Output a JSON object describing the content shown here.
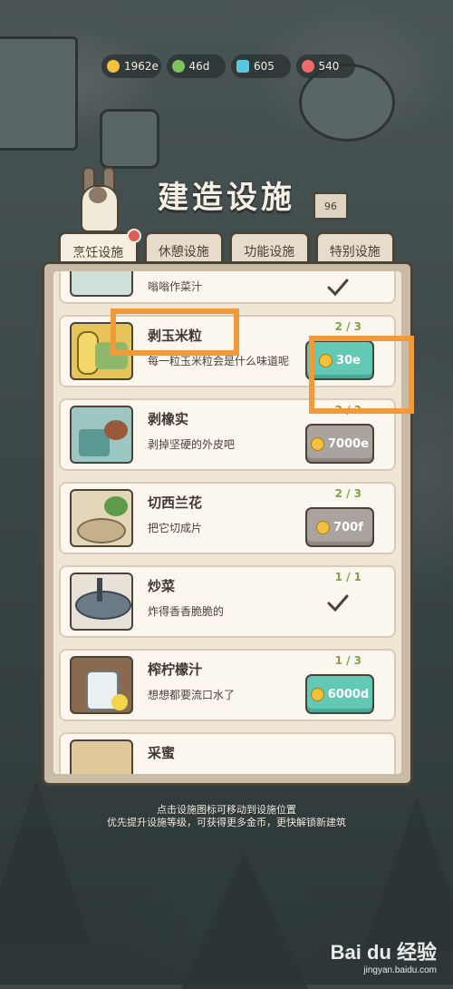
{
  "resources": [
    {
      "icon": "coin-icon",
      "value": "1962e",
      "color": "#f2c23c"
    },
    {
      "icon": "leaf-icon",
      "value": "46d",
      "color": "#7fc25a"
    },
    {
      "icon": "gem-icon",
      "value": "605",
      "color": "#5cc6e0"
    },
    {
      "icon": "heart-icon",
      "value": "540",
      "color": "#ef6a6a"
    }
  ],
  "header": {
    "title": "建造设施",
    "sign": "96"
  },
  "tabs": [
    {
      "label": "烹饪设施",
      "active": true,
      "badge": true
    },
    {
      "label": "休憩设施"
    },
    {
      "label": "功能设施"
    },
    {
      "label": "特别设施"
    }
  ],
  "items": [
    {
      "name": "",
      "desc": "嗡嗡作菜汁",
      "count": "",
      "state": "done"
    },
    {
      "name": "剥玉米粒",
      "desc": "每一粒玉米粒会是什么味道呢",
      "count": "2 / 3",
      "state": "green",
      "price": "30e"
    },
    {
      "name": "剥橡实",
      "desc": "剥掉坚硬的外皮吧",
      "count": "2 / 3",
      "state": "gray",
      "price": "7000e"
    },
    {
      "name": "切西兰花",
      "desc": "把它切成片",
      "count": "2 / 3",
      "state": "gray",
      "price": "700f"
    },
    {
      "name": "炒菜",
      "desc": "炸得香香脆脆的",
      "count": "1 / 1",
      "state": "done"
    },
    {
      "name": "榨柠檬汁",
      "desc": "想想都要流口水了",
      "count": "1 / 3",
      "state": "green",
      "price": "6000d"
    },
    {
      "name": "采蜜",
      "desc": "",
      "count": "",
      "state": "none"
    }
  ],
  "hints": {
    "line1": "点击设施图标可移动到设施位置",
    "line2": "优先提升设施等级，可获得更多金币，更快解锁新建筑"
  },
  "watermark": {
    "brand": "Bai du 经验",
    "url": "jingyan.baidu.com"
  },
  "colors": {
    "accent_green": "#63c8b4",
    "highlight_orange": "#f29a3a",
    "count_green": "#7ea34a"
  }
}
